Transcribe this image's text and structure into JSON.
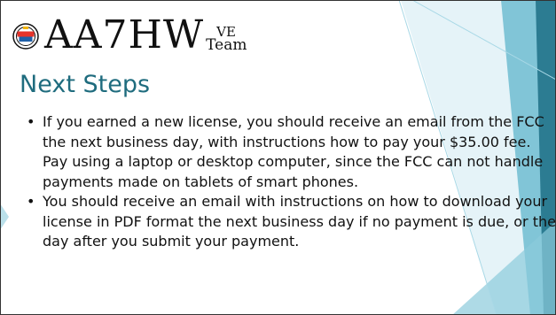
{
  "logo": {
    "badge_text": "HAM IT UP",
    "main_text": "AA7HW",
    "sup_text": "VE",
    "team_text": "Team"
  },
  "slide": {
    "title": "Next Steps",
    "bullets": [
      "If you earned a new license, you should receive an email from the FCC the next business day, with instructions how to pay your $35.00 fee. Pay using a laptop or desktop computer, since the FCC can not handle payments made on tablets of smart phones.",
      "You should receive an email with instructions on how to download your license in PDF format the next business day if no payment is due, or the day after you submit your payment."
    ]
  },
  "colors": {
    "title": "#1f6c7e",
    "accent_dark": "#1d6f86",
    "accent_mid": "#5fb6cc",
    "accent_light": "#bfe3ee"
  }
}
